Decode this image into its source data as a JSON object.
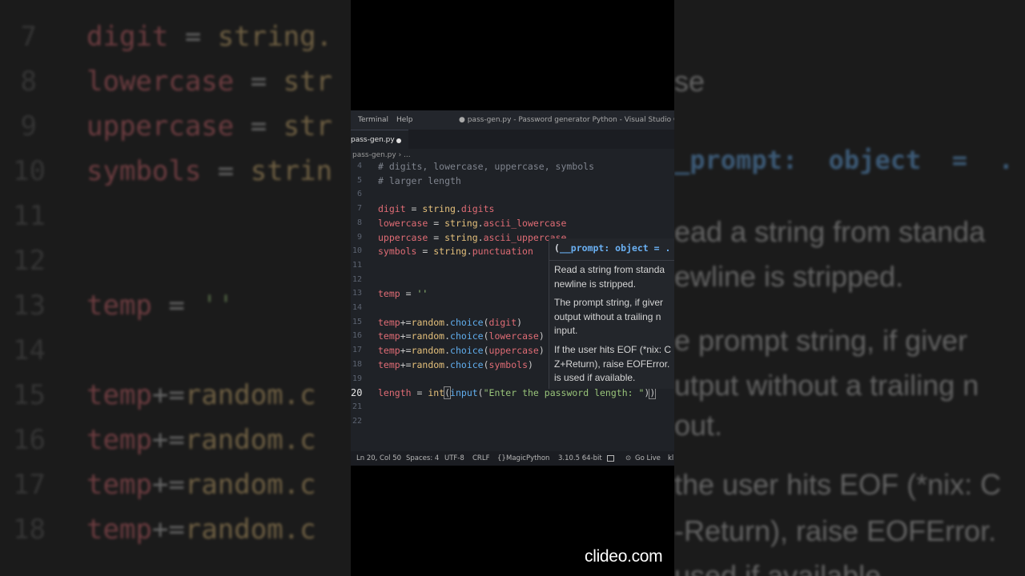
{
  "background": {
    "left_lines": [
      {
        "num": "7",
        "code": [
          [
            "digit",
            "c-var"
          ],
          [
            " = ",
            "c-op"
          ],
          [
            "string.",
            "c-fn"
          ]
        ]
      },
      {
        "num": "8",
        "code": [
          [
            "lowercase",
            "c-var"
          ],
          [
            " = ",
            "c-op"
          ],
          [
            "str",
            "c-fn"
          ]
        ]
      },
      {
        "num": "9",
        "code": [
          [
            "uppercase",
            "c-var"
          ],
          [
            " = ",
            "c-op"
          ],
          [
            "str",
            "c-fn"
          ]
        ]
      },
      {
        "num": "10",
        "code": [
          [
            "symbols",
            "c-var"
          ],
          [
            " = ",
            "c-op"
          ],
          [
            "strin",
            "c-fn"
          ]
        ]
      },
      {
        "num": "11",
        "code": []
      },
      {
        "num": "12",
        "code": []
      },
      {
        "num": "13",
        "code": [
          [
            "temp",
            "c-var"
          ],
          [
            " = ",
            "c-op"
          ],
          [
            "''",
            "c-str"
          ]
        ]
      },
      {
        "num": "14",
        "code": []
      },
      {
        "num": "15",
        "code": [
          [
            "temp",
            "c-var"
          ],
          [
            "+=",
            "c-op"
          ],
          [
            "random.c",
            "c-fn"
          ]
        ]
      },
      {
        "num": "16",
        "code": [
          [
            "temp",
            "c-var"
          ],
          [
            "+=",
            "c-op"
          ],
          [
            "random.c",
            "c-fn"
          ]
        ]
      },
      {
        "num": "17",
        "code": [
          [
            "temp",
            "c-var"
          ],
          [
            "+=",
            "c-op"
          ],
          [
            "random.c",
            "c-fn"
          ]
        ]
      },
      {
        "num": "18",
        "code": [
          [
            "temp",
            "c-var"
          ],
          [
            "+=",
            "c-op"
          ],
          [
            "random.c",
            "c-fn"
          ]
        ]
      }
    ],
    "right_lines": [
      {
        "text": "se",
        "style": "plain"
      },
      {
        "text": "_prompt:  object  =  .",
        "style": "mono"
      },
      {
        "text": "ead a string from standa",
        "style": "plain"
      },
      {
        "text": "ewline is stripped.",
        "style": "plain"
      },
      {
        "text": "e prompt string, if giver",
        "style": "plain"
      },
      {
        "text": "utput without a trailing n",
        "style": "plain"
      },
      {
        "text": "out.",
        "style": "plain"
      },
      {
        "text": "the user hits EOF (*nix: C",
        "style": "plain"
      },
      {
        "text": "-Return), raise EOFError.",
        "style": "plain"
      },
      {
        "text": "used if available.",
        "style": "plain"
      }
    ]
  },
  "titlebar": {
    "menu": [
      "Terminal",
      "Help"
    ],
    "title": "● pass-gen.py - Password generator Python - Visual Studio Code"
  },
  "tab": {
    "label": "pass-gen.py"
  },
  "breadcrumb": "pass-gen.py › ...",
  "editor": {
    "lines": [
      {
        "num": "4",
        "code": [
          [
            "# digits, lowercase, uppercase, symbols",
            "c-cmt"
          ]
        ]
      },
      {
        "num": "5",
        "code": [
          [
            "# larger length",
            "c-cmt"
          ]
        ]
      },
      {
        "num": "6",
        "code": []
      },
      {
        "num": "7",
        "code": [
          [
            "digit",
            "c-var"
          ],
          [
            " = ",
            "c-op"
          ],
          [
            "string",
            "c-fn"
          ],
          [
            ".",
            "c-op"
          ],
          [
            "digits",
            "c-attr"
          ]
        ]
      },
      {
        "num": "8",
        "code": [
          [
            "lowercase",
            "c-var"
          ],
          [
            " = ",
            "c-op"
          ],
          [
            "string",
            "c-fn"
          ],
          [
            ".",
            "c-op"
          ],
          [
            "ascii_lowercase",
            "c-attr"
          ]
        ]
      },
      {
        "num": "9",
        "code": [
          [
            "uppercase",
            "c-var"
          ],
          [
            " = ",
            "c-op"
          ],
          [
            "string",
            "c-fn"
          ],
          [
            ".",
            "c-op"
          ],
          [
            "ascii_uppercase",
            "c-attr"
          ]
        ]
      },
      {
        "num": "10",
        "code": [
          [
            "symbols",
            "c-var"
          ],
          [
            " = ",
            "c-op"
          ],
          [
            "string",
            "c-fn"
          ],
          [
            ".",
            "c-op"
          ],
          [
            "punctuation",
            "c-attr"
          ]
        ]
      },
      {
        "num": "11",
        "code": []
      },
      {
        "num": "12",
        "code": []
      },
      {
        "num": "13",
        "code": [
          [
            "temp",
            "c-var"
          ],
          [
            " = ",
            "c-op"
          ],
          [
            "''",
            "c-str"
          ]
        ]
      },
      {
        "num": "14",
        "code": []
      },
      {
        "num": "15",
        "code": [
          [
            "temp",
            "c-var"
          ],
          [
            "+=",
            "c-op"
          ],
          [
            "random",
            "c-fn"
          ],
          [
            ".",
            "c-op"
          ],
          [
            "choice",
            "c-call"
          ],
          [
            "(",
            "c-op"
          ],
          [
            "digit",
            "c-var"
          ],
          [
            ")",
            "c-op"
          ]
        ]
      },
      {
        "num": "16",
        "code": [
          [
            "temp",
            "c-var"
          ],
          [
            "+=",
            "c-op"
          ],
          [
            "random",
            "c-fn"
          ],
          [
            ".",
            "c-op"
          ],
          [
            "choice",
            "c-call"
          ],
          [
            "(",
            "c-op"
          ],
          [
            "lowercase",
            "c-var"
          ],
          [
            ")",
            "c-op"
          ]
        ]
      },
      {
        "num": "17",
        "code": [
          [
            "temp",
            "c-var"
          ],
          [
            "+=",
            "c-op"
          ],
          [
            "random",
            "c-fn"
          ],
          [
            ".",
            "c-op"
          ],
          [
            "choice",
            "c-call"
          ],
          [
            "(",
            "c-op"
          ],
          [
            "uppercase",
            "c-var"
          ],
          [
            ")",
            "c-op"
          ]
        ]
      },
      {
        "num": "18",
        "code": [
          [
            "temp",
            "c-var"
          ],
          [
            "+=",
            "c-op"
          ],
          [
            "random",
            "c-fn"
          ],
          [
            ".",
            "c-op"
          ],
          [
            "choice",
            "c-call"
          ],
          [
            "(",
            "c-op"
          ],
          [
            "symbols",
            "c-var"
          ],
          [
            ")",
            "c-op"
          ]
        ]
      },
      {
        "num": "19",
        "code": []
      },
      {
        "num": "20",
        "active": true,
        "code": [
          [
            "length",
            "c-var"
          ],
          [
            " = ",
            "c-op"
          ],
          [
            "int",
            "c-fn"
          ],
          [
            "(",
            "c-op"
          ],
          [
            "input",
            "c-call"
          ],
          [
            "(",
            "c-op"
          ],
          [
            "\"Enter the password length: \"",
            "c-str"
          ],
          [
            ")",
            "c-op"
          ],
          [
            ")",
            "c-op"
          ]
        ]
      },
      {
        "num": "21",
        "code": []
      },
      {
        "num": "22",
        "code": []
      }
    ]
  },
  "hover": {
    "signature_open": "(",
    "signature_param": "__prompt:",
    "signature_rest": " object = .",
    "paragraphs": [
      "Read a string from standa\nnewline is stripped.",
      "The prompt string, if giver\noutput without a trailing n\ninput.",
      "If the user hits EOF (*nix: C\nZ+Return), raise EOFError.\nis used if available."
    ]
  },
  "statusbar": {
    "position": "Ln 20, Col 50",
    "spaces": "Spaces: 4",
    "encoding": "UTF-8",
    "eol": "CRLF",
    "language": "MagicPython",
    "interpreter": "3.10.5 64-bit",
    "golive": "Go Live",
    "extra": "kl"
  },
  "watermark": "clideo.com"
}
